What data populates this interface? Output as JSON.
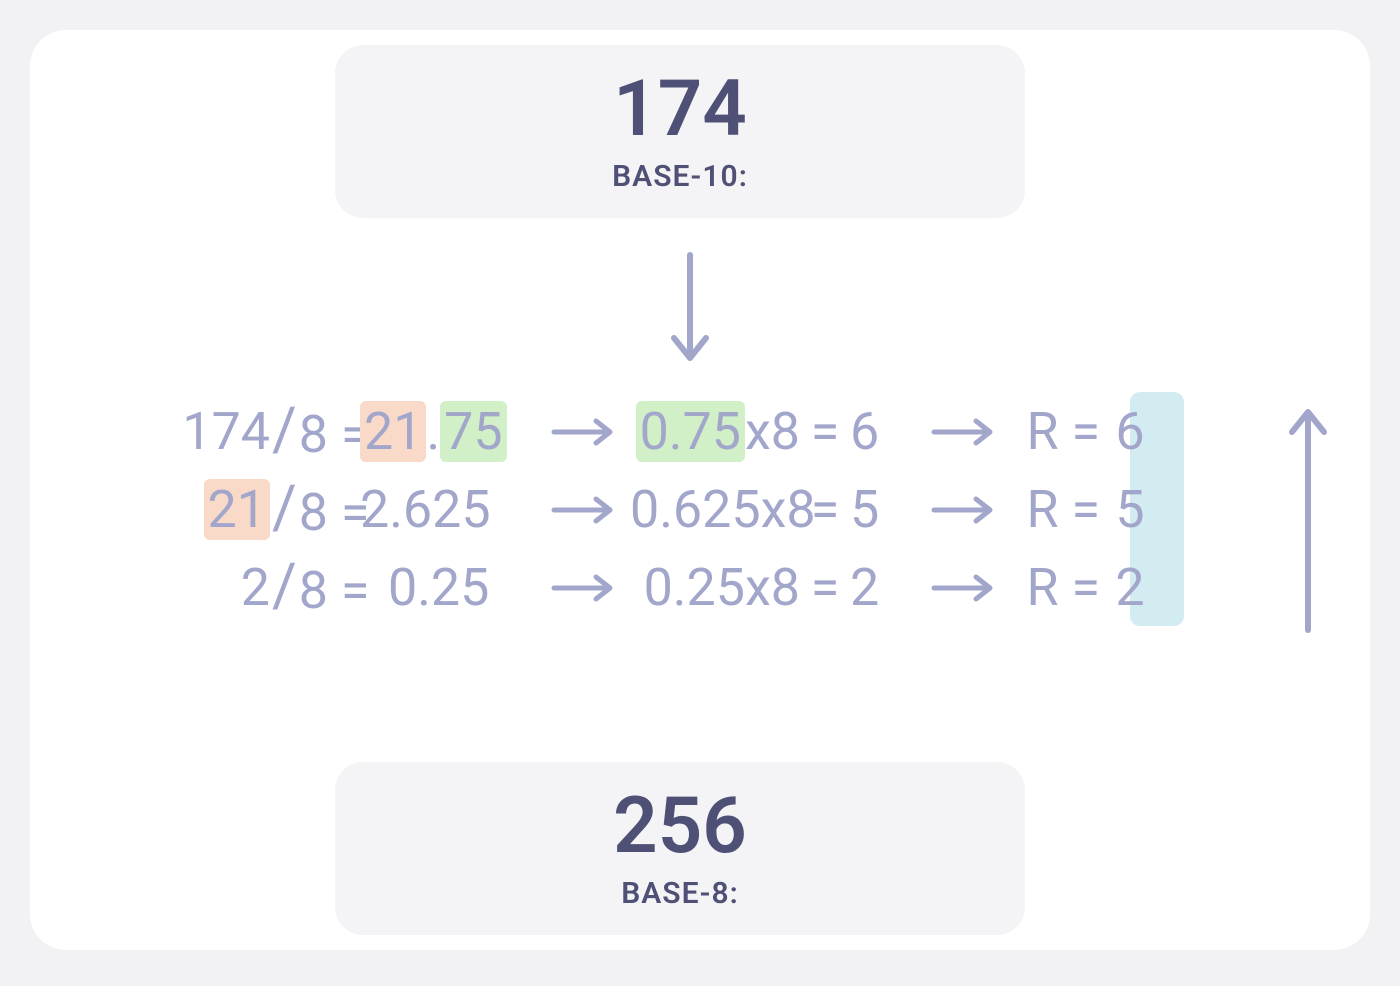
{
  "input": {
    "value": "174",
    "base_label": "BASE-10:"
  },
  "output": {
    "value": "256",
    "base_label": "BASE-8:"
  },
  "steps": [
    {
      "dividend_hl": null,
      "dividend": "174",
      "divisor": "8",
      "quot_int_hl": "21",
      "quot_dot": ".",
      "quot_frac_hl": "75",
      "mult_frac_hl": "0.75",
      "mult_by": "x8",
      "digit": "6",
      "remainder": "6"
    },
    {
      "dividend_hl": "21",
      "dividend": null,
      "divisor": "8",
      "quot_plain": "2.625",
      "mult_frac": "0.625",
      "mult_by": "x8",
      "digit": "5",
      "remainder": "5"
    },
    {
      "dividend_hl": null,
      "dividend": "2",
      "divisor": "8",
      "quot_plain": "0.25",
      "mult_frac": "0.25",
      "mult_by": "x8",
      "digit": "2",
      "remainder": "2"
    }
  ]
}
